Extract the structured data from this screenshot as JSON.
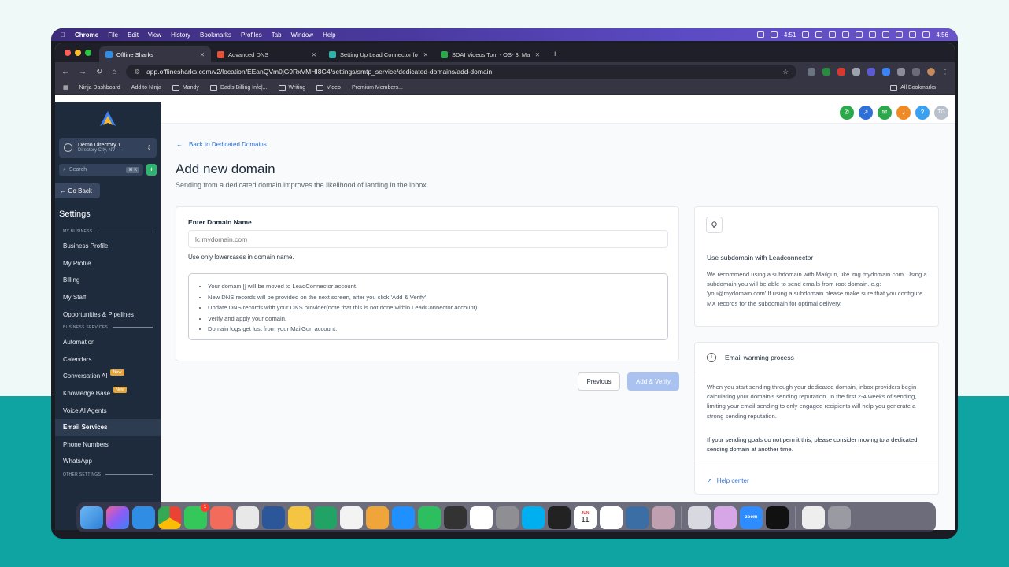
{
  "menubar": {
    "app": "Chrome",
    "items": [
      "File",
      "Edit",
      "View",
      "History",
      "Bookmarks",
      "Profiles",
      "Tab",
      "Window",
      "Help"
    ],
    "timer": "4:51",
    "clock": "4:56"
  },
  "tabs": [
    {
      "label": "Offline Sharks",
      "color": "#2f8de4"
    },
    {
      "label": "Advanced DNS",
      "color": "#e5533d"
    },
    {
      "label": "Setting Up Lead Connector fo",
      "color": "#2fb3a8"
    },
    {
      "label": "SDAI Videos Tom - OS- 3. Ma",
      "color": "#2aa84a"
    }
  ],
  "url": "app.offlinesharks.com/v2/location/EEanQVm0jG9RxVMHI8G4/settings/smtp_service/dedicated-domains/add-domain",
  "bookmarks": [
    "Ninja Dashboard",
    "Add to Ninja",
    "Mandy",
    "Dad's Billing Info|...",
    "Writing",
    "Video",
    "Premium Members..."
  ],
  "bookmarks_right": "All Bookmarks",
  "sidebar": {
    "location_name": "Demo Directory 1",
    "location_city": "Directory City, NV",
    "search_placeholder": "Search",
    "search_kbd": "⌘ K",
    "go_back": "← Go Back",
    "settings_title": "Settings",
    "section_business": "MY BUSINESS",
    "section_services": "BUSINESS SERVICES",
    "section_other": "OTHER SETTINGS",
    "business_items": [
      "Business Profile",
      "My Profile",
      "Billing",
      "My Staff",
      "Opportunities & Pipelines"
    ],
    "service_items": [
      "Automation",
      "Calendars",
      "Conversation AI",
      "Knowledge Base",
      "Voice AI Agents",
      "Email Services",
      "Phone Numbers",
      "WhatsApp"
    ],
    "new_badge": "New"
  },
  "topbar": {
    "avatar": "TG",
    "help": "?"
  },
  "main": {
    "back_link": "Back to Dedicated Domains",
    "title": "Add new domain",
    "subtitle": "Sending from a dedicated domain improves the likelihood of landing in the inbox.",
    "domain_label": "Enter Domain Name",
    "domain_placeholder": "lc.mydomain.com",
    "domain_hint": "Use only lowercases in domain name.",
    "info_items": [
      "Your domain [] will be moved to LeadConnector account.",
      "New DNS records will be provided on the next screen, after you click 'Add & Verify'",
      "Update DNS records with your DNS provider(note that this is not done within LeadConnector account).",
      "Verify and apply your domain.",
      "Domain logs get lost from your MailGun account."
    ],
    "previous_label": "Previous",
    "add_verify_label": "Add & Verify"
  },
  "tip": {
    "title": "Use subdomain with Leadconnector",
    "text": "We recommend using a subdomain with Mailgun, like 'mg.mydomain.com' Using a subdomain you will be able to send emails from root domain. e.g: 'you@mydomain.com' If using a subdomain please make sure that you configure MX records for the subdomain for optimal delivery."
  },
  "warming": {
    "title": "Email warming process",
    "text1": "When you start sending through your dedicated domain, inbox providers begin calculating your domain's sending reputation. In the first 2-4 weeks of sending, limiting your email sending to only engaged recipients will help you generate a strong sending reputation.",
    "text2": "If your sending goals do not permit this, please consider moving to a dedicated sending domain at another time.",
    "help_center": "Help center"
  },
  "dock": {
    "calendar_month": "JUN",
    "calendar_day": "11",
    "zoom": "zoom",
    "messages_badge": "1"
  }
}
